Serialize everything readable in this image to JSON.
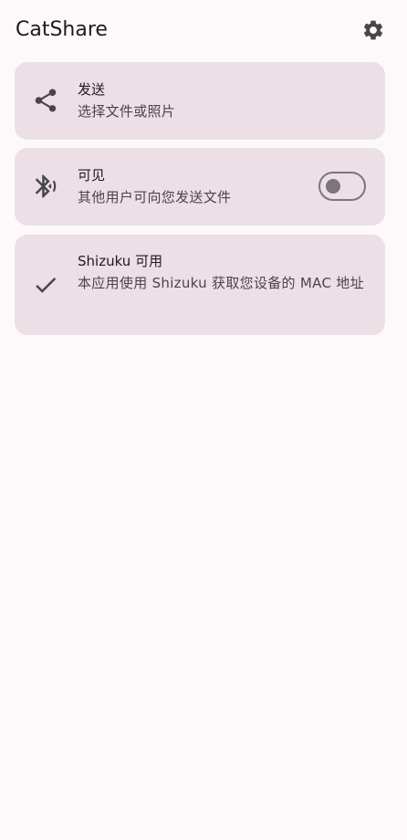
{
  "app_bar": {
    "title": "CatShare",
    "settings_icon": "gear-icon"
  },
  "cards": {
    "send": {
      "icon": "share-icon",
      "title": "发送",
      "subtitle": "选择文件或照片"
    },
    "visible": {
      "icon": "bluetooth-searching-icon",
      "title": "可见",
      "subtitle": "其他用户可向您发送文件",
      "switch_on": false
    },
    "shizuku": {
      "icon": "check-icon",
      "title": "Shizuku 可用",
      "subtitle": "本应用使用 Shizuku 获取您设备的 MAC 地址"
    }
  },
  "colors": {
    "background": "#fdf8f9",
    "card": "#ecdfe6",
    "icon": "#4a4549",
    "switch_outline": "#7c757b"
  }
}
